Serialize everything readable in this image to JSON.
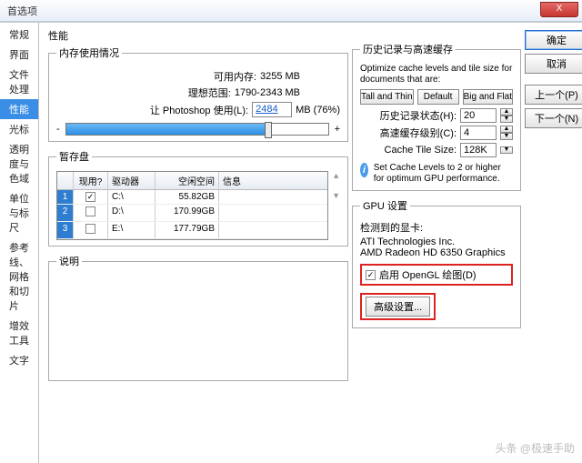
{
  "window": {
    "title": "首选项",
    "close": "X"
  },
  "sidebar": {
    "items": [
      "常规",
      "界面",
      "文件处理",
      "性能",
      "光标",
      "透明度与色域",
      "单位与标尺",
      "参考线、网格和切片",
      "增效工具",
      "文字"
    ],
    "selected_index": 3
  },
  "heading": "性能",
  "memory": {
    "legend": "内存使用情况",
    "available_label": "可用内存:",
    "available_value": "3255 MB",
    "ideal_label": "理想范围:",
    "ideal_value": "1790-2343 MB",
    "let_label": "让 Photoshop 使用(L):",
    "let_value": "2484",
    "let_unit": "MB (76%)",
    "fill_pct": 76,
    "minus": "-",
    "plus": "+"
  },
  "history": {
    "legend": "历史记录与高速缓存",
    "desc": "Optimize cache levels and tile size for documents that are:",
    "b1": "Tall and Thin",
    "b2": "Default",
    "b3": "Big and Flat",
    "states_label": "历史记录状态(H):",
    "states_value": "20",
    "levels_label": "高速缓存级别(C):",
    "levels_value": "4",
    "tile_label": "Cache Tile Size:",
    "tile_value": "128K",
    "info": "Set Cache Levels to 2 or higher for optimum GPU performance."
  },
  "scratch": {
    "legend": "暂存盘",
    "cols": [
      "",
      "现用?",
      "驱动器",
      "空闲空间",
      "信息"
    ],
    "rows": [
      {
        "n": "1",
        "active": true,
        "drive": "C:\\",
        "free": "55.82GB",
        "info": ""
      },
      {
        "n": "2",
        "active": false,
        "drive": "D:\\",
        "free": "170.99GB",
        "info": ""
      },
      {
        "n": "3",
        "active": false,
        "drive": "E:\\",
        "free": "177.79GB",
        "info": ""
      }
    ]
  },
  "gpu": {
    "legend": "GPU 设置",
    "detected_label": "检测到的显卡:",
    "vendor": "ATI Technologies Inc.",
    "card": "AMD Radeon HD 6350 Graphics",
    "enable_label": "启用 OpenGL 绘图(D)",
    "enable_checked": true,
    "advanced": "高级设置..."
  },
  "desc_legend": "说明",
  "buttons": {
    "ok": "确定",
    "cancel": "取消",
    "prev": "上一个(P)",
    "next": "下一个(N)"
  },
  "watermark": "头条 @极速手助"
}
